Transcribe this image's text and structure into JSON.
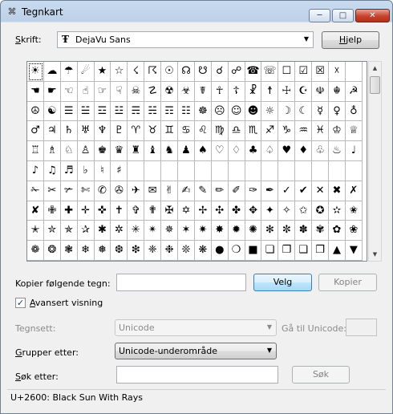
{
  "window": {
    "title": "Tegnkart",
    "min": "─",
    "max": "□",
    "close": "✕",
    "icon": "charmap-icon"
  },
  "font": {
    "label_prefix": "",
    "label_mnemonic": "S",
    "label_rest": "krift:",
    "value": "DejaVu Sans",
    "font_icon": "Ŧ",
    "arrow": "▼"
  },
  "help_button": {
    "mnemonic": "H",
    "rest": "jelp"
  },
  "grid": {
    "rows": [
      [
        "☀",
        "☁",
        "☂",
        "☄",
        "★",
        "☆",
        "☇",
        "☈",
        "☉",
        "☊",
        "☋",
        "☌",
        "☍",
        "☎",
        "☏",
        "☐",
        "☑",
        "☒",
        "☓"
      ],
      [
        "☚",
        "☛",
        "☜",
        "☝",
        "☞",
        "☟",
        "☠",
        "☡",
        "☢",
        "☣",
        "☤",
        "☥",
        "☦",
        "☧",
        "☨",
        "☩",
        "☪",
        "☫",
        "☬",
        "☭"
      ],
      [
        "☮",
        "☯",
        "☰",
        "☱",
        "☲",
        "☳",
        "☴",
        "☵",
        "☶",
        "☷",
        "☸",
        "☹",
        "☺",
        "☻",
        "☼",
        "☽",
        "☾",
        "☿",
        "♀",
        "♁"
      ],
      [
        "♂",
        "♃",
        "♄",
        "♅",
        "♆",
        "♇",
        "♈",
        "♉",
        "♊",
        "♋",
        "♌",
        "♍",
        "♎",
        "♏",
        "♐",
        "♑",
        "♒",
        "♓",
        "♔",
        "♕"
      ],
      [
        "♖",
        "♗",
        "♘",
        "♙",
        "♚",
        "♛",
        "♜",
        "♝",
        "♞",
        "♟",
        "♠",
        "♡",
        "♢",
        "♣",
        "♤",
        "♥",
        "♦",
        "♧",
        "♨",
        "♩"
      ],
      [
        "♪",
        "♫",
        "♬",
        "♭",
        "♮",
        "♯",
        "",
        "",
        "",
        "",
        "",
        "",
        "",
        "",
        "",
        "",
        "",
        "",
        "",
        ""
      ],
      [
        "✁",
        "✂",
        "✃",
        "✄",
        "✆",
        "✇",
        "✈",
        "✉",
        "✌",
        "✍",
        "✎",
        "✏",
        "✐",
        "✑",
        "✒",
        "✓",
        "✔",
        "✕",
        "✖",
        "✗"
      ],
      [
        "✘",
        "✙",
        "✚",
        "✛",
        "✜",
        "✝",
        "✞",
        "✟",
        "✠",
        "✡",
        "✢",
        "✣",
        "✤",
        "✥",
        "✦",
        "✧",
        "✩",
        "✪",
        "✫",
        "✬"
      ],
      [
        "✭",
        "✮",
        "✯",
        "✰",
        "✱",
        "✲",
        "✳",
        "✴",
        "✵",
        "✶",
        "✷",
        "✸",
        "✹",
        "✺",
        "✻",
        "✼",
        "✽",
        "✾",
        "✿",
        "❀"
      ],
      [
        "❁",
        "❂",
        "❃",
        "❄",
        "❅",
        "❆",
        "❇",
        "❈",
        "❉",
        "❊",
        "❋",
        "●",
        "❍",
        "■",
        "❏",
        "❐",
        "❑",
        "❒",
        "▲",
        "▼"
      ]
    ]
  },
  "copy": {
    "label": "Kopier følgende tegn:",
    "value": "",
    "select": "Velg",
    "copy": "Kopier"
  },
  "advanced": {
    "checked": "✓",
    "mnemonic": "A",
    "rest": "vansert visning"
  },
  "charset": {
    "label": "Tegnsett:",
    "value": "Unicode",
    "arrow": "▼",
    "goto_label": "Gå til Unicode:",
    "goto_value": ""
  },
  "group": {
    "mnemonic": "G",
    "rest": "rupper etter:",
    "value": "Unicode-underområde",
    "arrow": "▼"
  },
  "search": {
    "mnemonic": "S",
    "rest": "øk etter:",
    "value": "",
    "button": "Søk"
  },
  "status": {
    "text": "U+2600: Black Sun With Rays"
  },
  "scroll": {
    "up": "▲",
    "down": "▼"
  }
}
